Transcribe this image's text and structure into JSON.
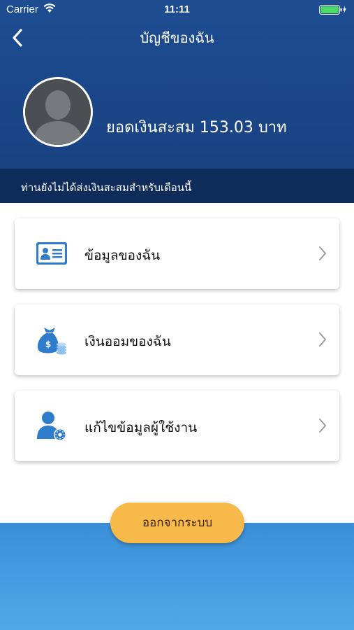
{
  "status_bar": {
    "carrier": "Carrier",
    "time": "11:11"
  },
  "nav": {
    "title": "บัญชีของฉัน",
    "back_icon": "chevron-left-icon"
  },
  "profile": {
    "avatar_icon": "user-silhouette-icon",
    "balance_text": "ยอดเงินสะสม 153.03 บาท"
  },
  "notice": {
    "text": "ท่านยังไม่ได้ส่งเงินสะสมสำหรับเดือนนี้"
  },
  "menu": [
    {
      "label": "ข้อมูลของฉัน",
      "icon": "id-card-icon"
    },
    {
      "label": "เงินออมของฉัน",
      "icon": "money-bag-icon"
    },
    {
      "label": "แก้ไขข้อมูลผู้ใช้งาน",
      "icon": "user-settings-icon"
    }
  ],
  "logout": {
    "label": "ออกจากระบบ"
  },
  "colors": {
    "header_blue": "#1e4d92",
    "notice_band": "#0f2b5a",
    "icon_blue": "#2f7ccc",
    "logout_orange": "#f6b94a",
    "bottom_blue": "#4aa3e3"
  }
}
